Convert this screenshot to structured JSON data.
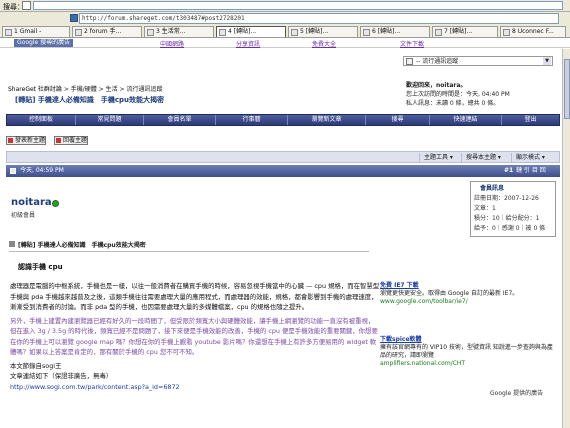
{
  "search_bar": {
    "label": "搜尋："
  },
  "address_bar": {
    "url": "http://forum.shareget.com/t303487#post2728201"
  },
  "tabs": [
    {
      "label": "1 Gmail -"
    },
    {
      "label": "2 forum 手..."
    },
    {
      "label": "3 生活常..."
    },
    {
      "label": "4 [轉貼]..."
    },
    {
      "label": "5 [轉貼]..."
    },
    {
      "label": "6 [轉貼]..."
    },
    {
      "label": "7 [轉貼]..."
    },
    {
      "label": "8 Uconnec F..."
    }
  ],
  "google_bar": {
    "logo": "Google 搜尋的廣告",
    "links": [
      "中國網路",
      "分享資訊",
      "免費大全",
      "文件下載"
    ]
  },
  "header": {
    "dropdown": "-- 流行通訊追蹤"
  },
  "breadcrumb": {
    "site": "ShareGet 社群討論",
    "sep1": " > 手機/硬體 > 生活 > ",
    "current": "流行通訊追蹤"
  },
  "thread": {
    "tag": "[轉貼]",
    "title": "手機達人必備知識　手機cpu效能大揭密"
  },
  "user_panel": {
    "welcome": "歡迎回來，noitara。",
    "last_visit": "您上次訪問的時間是：今天, 04:40 PM",
    "pm_label": "私人訊息：未讀 0 條，總共 0 條。"
  },
  "navbar": {
    "items": [
      "控制面板",
      "常見問題",
      "會員名單",
      "行事曆",
      "瀏覽新文章",
      "搜尋",
      "快速連結",
      "登出"
    ]
  },
  "buttons": {
    "new_thread": "發表新主題",
    "reply": "回覆主題"
  },
  "toolbar": {
    "thread_tools": "主題工具",
    "search_thread": "搜尋本主題",
    "display_mode": "顯示模式"
  },
  "post": {
    "date": "今天, 04:59 PM",
    "number": "#1",
    "meta": "鏈 引 目 回",
    "author": "noitara",
    "rank": "初級會員",
    "info": {
      "title": "會員訊息",
      "join_date": "註冊日期：2007-12-26",
      "posts": "文章：1",
      "points": "積分：10｜給分配分：1",
      "gifts": "給予：0｜感謝 0｜被 0 條"
    },
    "thread_heading": "[轉貼] 手機達人必備知識　手機cpu效能大揭密",
    "subtitle": "認識手機 cpu",
    "paragraphs": [
      "處理器是電腦的中樞系統，手機也是一樣，以往一般消費者在購買手機的時候，容易忽視手機當中的心臟 — cpu 規格，而在智慧型手機與 pda 手機越來越普及之後，這類手機往往需要處理大量的應用程式，而處理器的效能，規格，都會影響到手機的處理速度，漸漸受到消費者的討論。而非 pda 型的手機，也因需要處理大量的多媒體檔案，cpu 的規格也隨之提升。",
      "另外，手機上建置內建瀏覽器已經有好久的一段時間了，但受限於頻寬大小與硬體效能，讓手機上網瀏覽的功能一直沒有被重視，但在進入 3g / 3.5g 的時代後，頻寬已經不是問題了，接下來便是手機效能的改善，手機的 cpu 便是手機效能的重要關鍵，你想要在你的手機上可以瀏覽 google map 嗎？你想在你的手機上觀看 youtube 影片嗎？你還想在手機上有許多方便易用的 widget 軟體嗎？如果以上答案是肯定的，那有關於手機的 cpu 您不可不知。"
    ],
    "source_label": "本文節錄自sogi王",
    "link_label": "文章連結如下（保證非廣告，無毒）",
    "link_url": "http://www.sogi.com.tw/park/content.asp?a_id=6872"
  },
  "ads": [
    {
      "title": "免費 IE7 下載",
      "desc": "瀏覽更快更安全。取得由 Google 自訂的最新 IE7。",
      "url": "www.google.com/toolbar/ie7/"
    },
    {
      "title": "下載spice軟體",
      "desc": "擁有該官網專有的 VIP10 技術，型號資訊 知說進一步查詢與為產品的研究，請即瀏覽",
      "url": "amplifiers.national.com/CHT"
    }
  ],
  "google_ads_label": "Google 提供的廣告",
  "colors": {
    "navbar": "#3d4a88",
    "title": "#1d3d7a",
    "link": "#1a3da8",
    "purple": "#7a4aa8"
  }
}
